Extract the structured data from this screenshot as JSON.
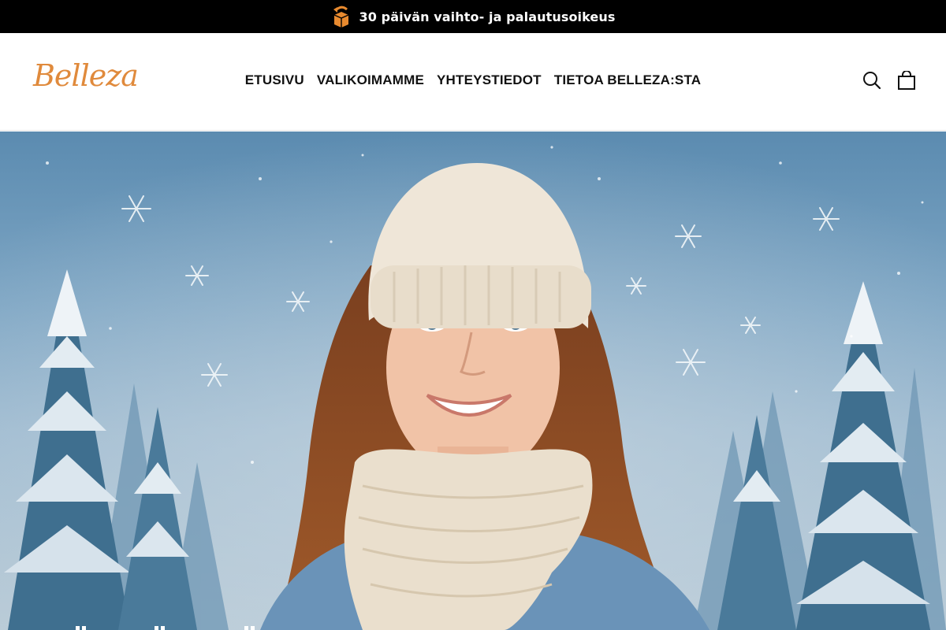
{
  "announcement": {
    "icon": "return-box-icon",
    "text": "30 päivän vaihto- ja palautusoikeus"
  },
  "header": {
    "logo": "Belleza",
    "nav": [
      {
        "label": "ETUSIVU"
      },
      {
        "label": "VALIKOIMAMME"
      },
      {
        "label": "YHTEYSTIEDOT"
      },
      {
        "label": "TIETOA BELLEZA:STA"
      }
    ],
    "icons": [
      "search-icon",
      "cart-icon"
    ]
  },
  "hero": {
    "image": "woman-in-winter-hat-and-scarf-snowy-forest"
  },
  "colors": {
    "brand": "#e08a3c",
    "announce_bg": "#000000",
    "text": "#111111"
  }
}
